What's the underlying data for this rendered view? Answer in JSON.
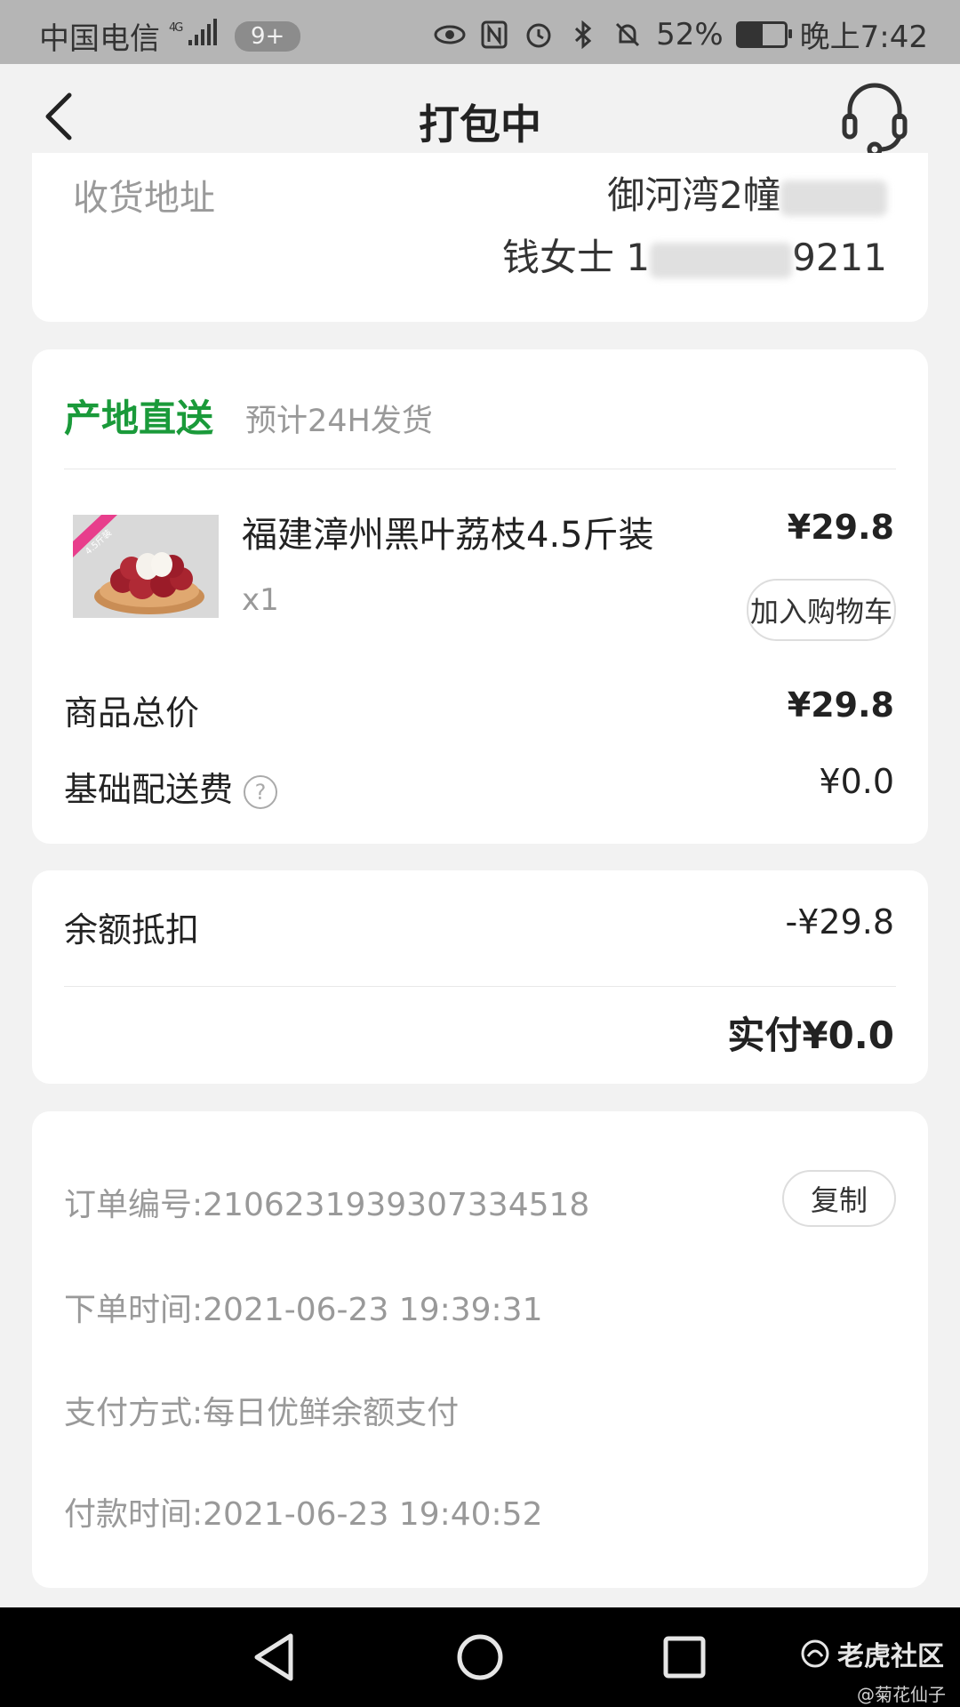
{
  "status_bar": {
    "carrier": "中国电信",
    "network": "4G",
    "notification_badge": "9+",
    "battery_percent": "52%",
    "battery_level": 0.52,
    "time": "晚上7:42"
  },
  "header": {
    "title": "打包中"
  },
  "address": {
    "label": "收货地址",
    "line1_visible": "御河湾2幢",
    "recipient": "钱女士 1",
    "phone_tail": "9211"
  },
  "order": {
    "shipping_tag": "产地直送",
    "shipping_note": "预计24H发货",
    "product": {
      "badge": "4.5斤装",
      "name": "福建漳州黑叶荔枝4.5斤装",
      "price": "¥29.8",
      "quantity": "x1",
      "add_to_cart": "加入购物车"
    },
    "subtotal_label": "商品总价",
    "subtotal_value": "¥29.8",
    "delivery_label": "基础配送费",
    "delivery_value": "¥0.0"
  },
  "payment": {
    "balance_label": "余额抵扣",
    "balance_value": "-¥29.8",
    "actual_paid": "实付¥0.0"
  },
  "info": {
    "order_no_label": "订单编号:",
    "order_no_value": "2106231939307334518",
    "copy_label": "复制",
    "order_time_label": "下单时间:",
    "order_time_value": "2021-06-23 19:39:31",
    "pay_method_label": "支付方式:",
    "pay_method_value": "每日优鲜余额支付",
    "pay_time_label": "付款时间:",
    "pay_time_value": "2021-06-23 19:40:52"
  },
  "watermark": {
    "name": "老虎社区",
    "author": "@菊花仙子"
  }
}
